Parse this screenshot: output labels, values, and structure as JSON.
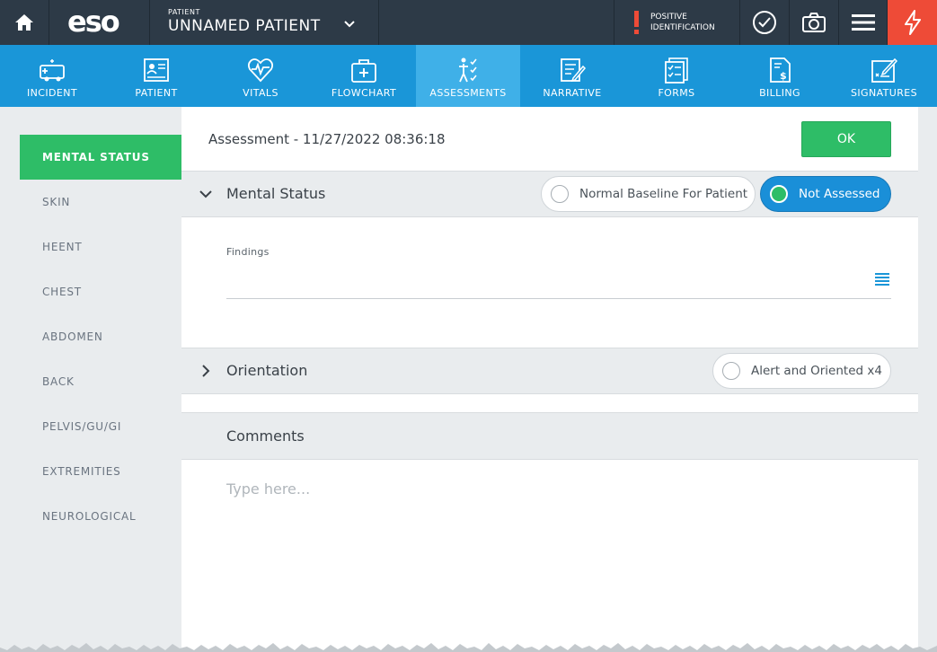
{
  "topbar": {
    "logo": "eso",
    "patient_small": "PATIENT",
    "patient_name": "UNNAMED PATIENT",
    "positive_id_line1": "POSITIVE",
    "positive_id_line2": "IDENTIFICATION",
    "alert_color": "#ee4b37"
  },
  "nav": {
    "items": [
      {
        "label": "INCIDENT",
        "icon": "ambulance-icon"
      },
      {
        "label": "PATIENT",
        "icon": "patient-card-icon"
      },
      {
        "label": "VITALS",
        "icon": "heart-pulse-icon"
      },
      {
        "label": "FLOWCHART",
        "icon": "medical-bag-icon"
      },
      {
        "label": "ASSESSMENTS",
        "icon": "body-check-icon",
        "active": true
      },
      {
        "label": "NARRATIVE",
        "icon": "document-pen-icon"
      },
      {
        "label": "FORMS",
        "icon": "checklist-icon"
      },
      {
        "label": "BILLING",
        "icon": "billing-icon"
      },
      {
        "label": "SIGNATURES",
        "icon": "signature-icon"
      }
    ]
  },
  "sidebar": {
    "items": [
      {
        "label": "MENTAL STATUS",
        "active": true
      },
      {
        "label": "SKIN"
      },
      {
        "label": "HEENT"
      },
      {
        "label": "CHEST"
      },
      {
        "label": "ABDOMEN"
      },
      {
        "label": "BACK"
      },
      {
        "label": "PELVIS/GU/GI"
      },
      {
        "label": "EXTREMITIES"
      },
      {
        "label": "NEUROLOGICAL"
      }
    ]
  },
  "main": {
    "title": "Assessment - 11/27/2022 08:36:18",
    "ok_label": "OK",
    "mental_status": {
      "title": "Mental Status",
      "option_normal": "Normal Baseline For Patient",
      "option_not_assessed": "Not Assessed",
      "selected": "Not Assessed",
      "findings_label": "Findings",
      "findings_value": ""
    },
    "orientation": {
      "title": "Orientation",
      "option": "Alert and Oriented x4"
    },
    "comments": {
      "title": "Comments",
      "placeholder": "Type here...",
      "value": ""
    }
  },
  "colors": {
    "accent_blue": "#1a96d8",
    "green": "#2ebd67",
    "dark_header": "#2d3a47"
  }
}
